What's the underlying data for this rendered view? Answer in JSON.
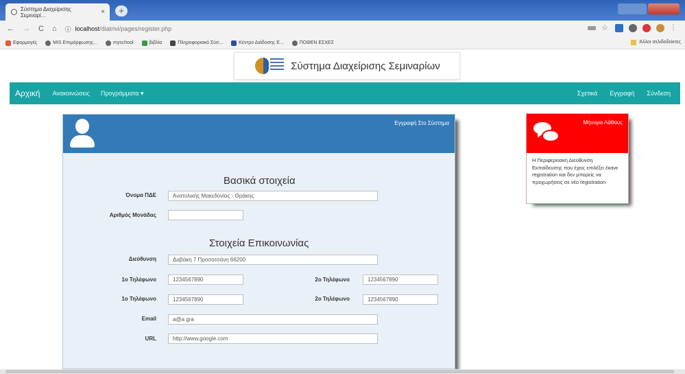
{
  "browser": {
    "tab_title": "Σύστημα Διαχείρισης Σεμιναρί...",
    "tab_close": "×",
    "new_tab": "+",
    "url_host": "localhost",
    "url_path": "/diatrivi/pages/register.php",
    "bookmarks": [
      {
        "label": "Εφαρμογές"
      },
      {
        "label": "MIS Επιμόρφωσης..."
      },
      {
        "label": "myschool"
      },
      {
        "label": "βιβλία"
      },
      {
        "label": "Πληροφοριακό Σύσ..."
      },
      {
        "label": "Κέντρο Διάδοσης Ε..."
      },
      {
        "label": "ΠΟΘΕΝ ΕΣΧΕΣ"
      }
    ],
    "other_bookmarks": "Άλλοι σελιδοδείκτες"
  },
  "site": {
    "title": "Σύστημα Διαχείρισης Σεμιναρίων",
    "colors": {
      "navbar": "#1aa3a3",
      "panel_head": "#337ab7",
      "error": "#ff0000"
    }
  },
  "nav": {
    "brand": "Αρχική",
    "left": [
      "Ανακοινώσεις",
      "Προγράμματα ▾"
    ],
    "right": [
      "Σχετικά",
      "Εγγραφή",
      "Σύνδεση"
    ]
  },
  "form": {
    "panel_title": "Εγγραφή Στο Σύστημα",
    "section_basic": "Βασικά στοιχεία",
    "section_contact": "Στοιχεία Επικοινωνίας",
    "fields": {
      "pde_label": "Όνομα ΠΔΕ",
      "pde_value": "Ανατολικής Μακεδονίας - Θράκης",
      "unit_label": "Αριθμός Μονάδας",
      "unit_value": "",
      "address_label": "Διεύθυνση",
      "address_value": "Δαβάκη 7 Προσοτσάνη 66200",
      "phone1a_label": "1ο Τηλέφωνο",
      "phone1a_value": "1234567890",
      "phone2a_label": "2ο Τηλέφωνο",
      "phone2a_value": "1234567890",
      "phone1b_label": "1ο Τηλέφωνο",
      "phone1b_value": "1234567890",
      "phone2b_label": "2ο Τηλέφωνο",
      "phone2b_value": "1234567890",
      "email_label": "Email",
      "email_value": "a@a gra",
      "url_label": "URL",
      "url_value": "http://www.google.com"
    }
  },
  "error": {
    "title": "Μήνυμα Λάθους",
    "message": "Η Περιφερειακή Διεύθυνση Εκπαίδευσης που έχεις επιλέξει έκανε registration και δεν μπορείς να προχωρήσεις σε νέο registration"
  }
}
